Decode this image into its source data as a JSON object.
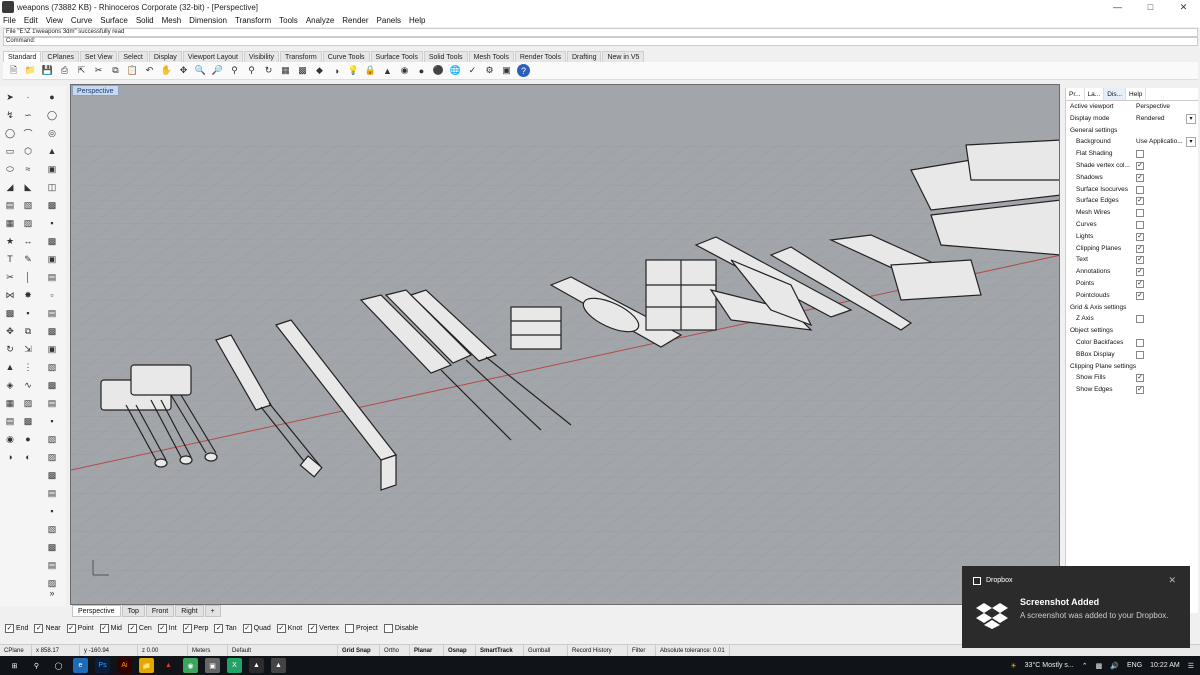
{
  "window": {
    "title": "weapons (73882 KB) - Rhinoceros Corporate (32-bit) - [Perspective]"
  },
  "menu": [
    "File",
    "Edit",
    "View",
    "Curve",
    "Surface",
    "Solid",
    "Mesh",
    "Dimension",
    "Transform",
    "Tools",
    "Analyze",
    "Render",
    "Panels",
    "Help"
  ],
  "command": {
    "history": "File \"E:\\Z 1\\weapons 3dm\" successfully read",
    "prompt": "Command:"
  },
  "toolbar_tabs": [
    "Standard",
    "CPlanes",
    "Set View",
    "Select",
    "Display",
    "Viewport Layout",
    "Visibility",
    "Transform",
    "Curve Tools",
    "Surface Tools",
    "Solid Tools",
    "Mesh Tools",
    "Render Tools",
    "Drafting",
    "New in V5"
  ],
  "viewport": {
    "label": "Perspective",
    "tabs": [
      "Perspective",
      "Top",
      "Front",
      "Right"
    ],
    "add_tab": "+"
  },
  "panel": {
    "tabs": [
      "Pr...",
      "La...",
      "Dis...",
      "Help"
    ],
    "active_viewport_label": "Active viewport",
    "active_viewport_value": "Perspective",
    "display_mode_label": "Display mode",
    "display_mode_value": "Rendered",
    "general_header": "General settings",
    "background_label": "Background",
    "background_value": "Use Applicatio...",
    "general_items": [
      {
        "label": "Flat Shading",
        "checked": false
      },
      {
        "label": "Shade vertex col...",
        "checked": true
      },
      {
        "label": "Shadows",
        "checked": true
      },
      {
        "label": "Surface Isocurves",
        "checked": false
      },
      {
        "label": "Surface Edges",
        "checked": true
      },
      {
        "label": "Mesh Wires",
        "checked": false
      },
      {
        "label": "Curves",
        "checked": false
      },
      {
        "label": "Lights",
        "checked": true
      },
      {
        "label": "Clipping Planes",
        "checked": true
      },
      {
        "label": "Text",
        "checked": true
      },
      {
        "label": "Annotations",
        "checked": true
      },
      {
        "label": "Points",
        "checked": true
      },
      {
        "label": "Pointclouds",
        "checked": true
      }
    ],
    "grid_header": "Grid & Axis settings",
    "grid_items": [
      {
        "label": "Z Axis",
        "checked": false
      }
    ],
    "object_header": "Object settings",
    "object_items": [
      {
        "label": "Color Backfaces",
        "checked": false
      },
      {
        "label": "BBox Display",
        "checked": false
      }
    ],
    "clip_header": "Clipping Plane settings",
    "clip_items": [
      {
        "label": "Show Fills",
        "checked": true
      },
      {
        "label": "Show Edges",
        "checked": true
      }
    ]
  },
  "osnaps": [
    {
      "label": "End",
      "checked": true
    },
    {
      "label": "Near",
      "checked": true
    },
    {
      "label": "Point",
      "checked": true
    },
    {
      "label": "Mid",
      "checked": true
    },
    {
      "label": "Cen",
      "checked": true
    },
    {
      "label": "Int",
      "checked": true
    },
    {
      "label": "Perp",
      "checked": true
    },
    {
      "label": "Tan",
      "checked": true
    },
    {
      "label": "Quad",
      "checked": true
    },
    {
      "label": "Knot",
      "checked": true
    },
    {
      "label": "Vertex",
      "checked": true
    },
    {
      "label": "Project",
      "checked": false
    },
    {
      "label": "Disable",
      "checked": false
    }
  ],
  "status": {
    "cplane": "CPlane",
    "x": "x 858.17",
    "y": "y -160.94",
    "z": "z 0.00",
    "units": "Meters",
    "layer": "Default",
    "grid_snap": "Grid Snap",
    "ortho": "Ortho",
    "planar": "Planar",
    "osnap": "Osnap",
    "smarttrack": "SmartTrack",
    "gumball": "Gumball",
    "record_history": "Record History",
    "filter": "Filter",
    "tolerance": "Absolute tolerance: 0.01"
  },
  "taskbar": {
    "weather": "33°C  Mostly s...",
    "language": "ENG",
    "time": "10:22 AM"
  },
  "toast": {
    "app": "Dropbox",
    "title": "Screenshot Added",
    "message": "A screenshot was added to your Dropbox."
  }
}
